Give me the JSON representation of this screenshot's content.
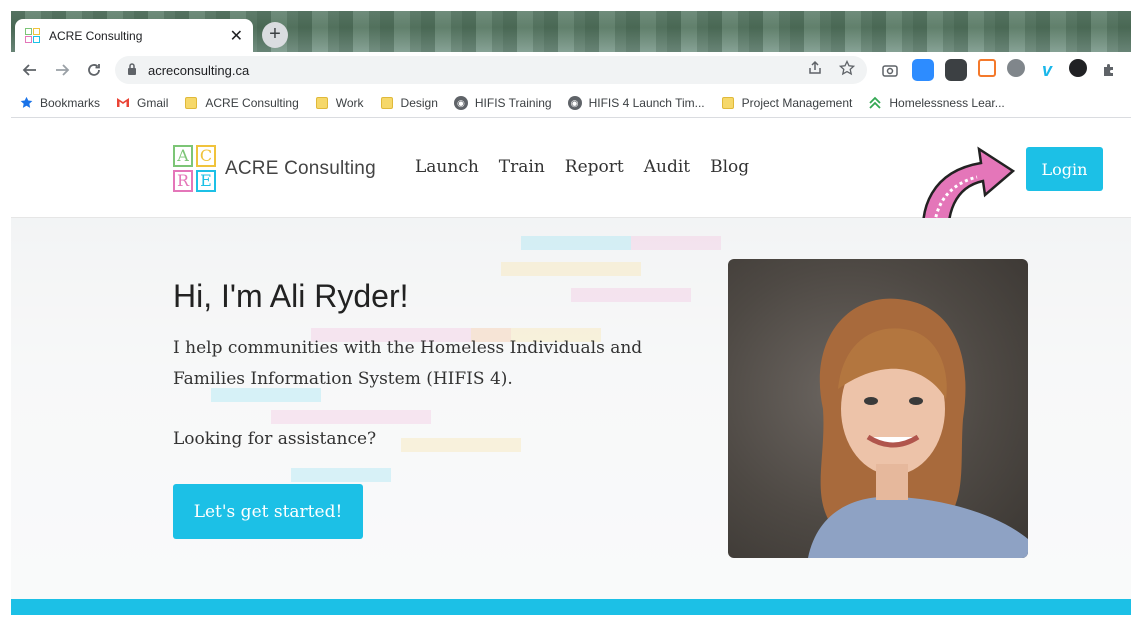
{
  "browser": {
    "tab_title": "ACRE Consulting",
    "tab_close": "✕",
    "new_tab": "+",
    "url": "acreconsulting.ca",
    "nav_icons": [
      "back-icon",
      "forward-icon",
      "reload-icon"
    ],
    "bookmarks": [
      {
        "label": "Bookmarks",
        "icon": "star-icon"
      },
      {
        "label": "Gmail",
        "icon": "gmail-icon"
      },
      {
        "label": "ACRE Consulting",
        "icon": "folder-icon"
      },
      {
        "label": "Work",
        "icon": "folder-icon"
      },
      {
        "label": "Design",
        "icon": "folder-icon"
      },
      {
        "label": "HIFIS Training",
        "icon": "globe-icon"
      },
      {
        "label": "HIFIS 4 Launch Tim...",
        "icon": "globe-icon"
      },
      {
        "label": "Project Management",
        "icon": "folder-icon"
      },
      {
        "label": "Homelessness Lear...",
        "icon": "chevron-up-icon"
      }
    ]
  },
  "site": {
    "logo_letters": [
      "A",
      "C",
      "R",
      "E"
    ],
    "logo_text": "ACRE Consulting",
    "nav": [
      "Launch",
      "Train",
      "Report",
      "Audit",
      "Blog"
    ],
    "login": "Login",
    "hero": {
      "heading": "Hi, I'm Ali Ryder!",
      "subtext": "I help communities with the Homeless Individuals and Families Information System (HIFIS 4).",
      "question": "Looking for assistance?",
      "cta": "Let's get started!"
    }
  },
  "colors": {
    "accent": "#1cc0e6",
    "arrow": "#e476b9"
  }
}
